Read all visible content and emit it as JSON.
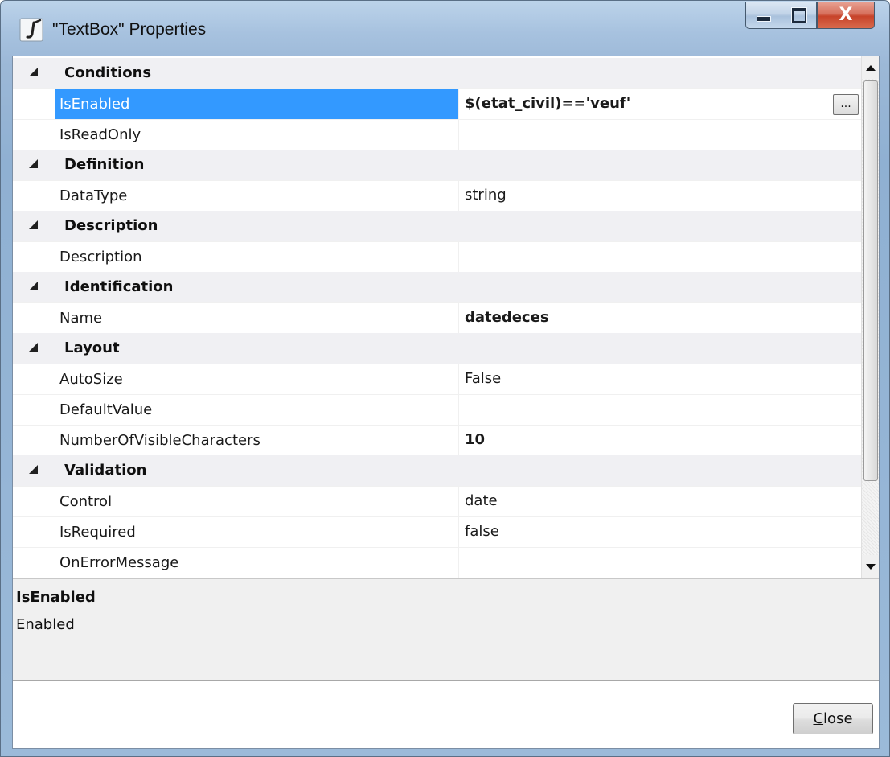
{
  "window": {
    "title": "\"TextBox\" Properties",
    "close_glyph": "X",
    "icon": "script-j-icon"
  },
  "grid": {
    "rows": [
      {
        "kind": "category",
        "label": "Conditions"
      },
      {
        "kind": "property",
        "name": "IsEnabled",
        "value": "$(etat_civil)=='veuf'",
        "bold": true,
        "selected": true,
        "has_button": true
      },
      {
        "kind": "property",
        "name": "IsReadOnly",
        "value": ""
      },
      {
        "kind": "category",
        "label": "Definition"
      },
      {
        "kind": "property",
        "name": "DataType",
        "value": "string"
      },
      {
        "kind": "category",
        "label": "Description"
      },
      {
        "kind": "property",
        "name": "Description",
        "value": ""
      },
      {
        "kind": "category",
        "label": "Identification"
      },
      {
        "kind": "property",
        "name": "Name",
        "value": "datedeces",
        "bold": true
      },
      {
        "kind": "category",
        "label": "Layout"
      },
      {
        "kind": "property",
        "name": "AutoSize",
        "value": "False"
      },
      {
        "kind": "property",
        "name": "DefaultValue",
        "value": ""
      },
      {
        "kind": "property",
        "name": "NumberOfVisibleCharacters",
        "value": "10",
        "bold": true
      },
      {
        "kind": "category",
        "label": "Validation"
      },
      {
        "kind": "property",
        "name": "Control",
        "value": "date"
      },
      {
        "kind": "property",
        "name": "IsRequired",
        "value": "false"
      },
      {
        "kind": "property",
        "name": "OnErrorMessage",
        "value": ""
      }
    ],
    "ellipsis_label": "..."
  },
  "description": {
    "title": "IsEnabled",
    "text": "Enabled"
  },
  "footer": {
    "close_accel": "C",
    "close_rest": "lose"
  }
}
